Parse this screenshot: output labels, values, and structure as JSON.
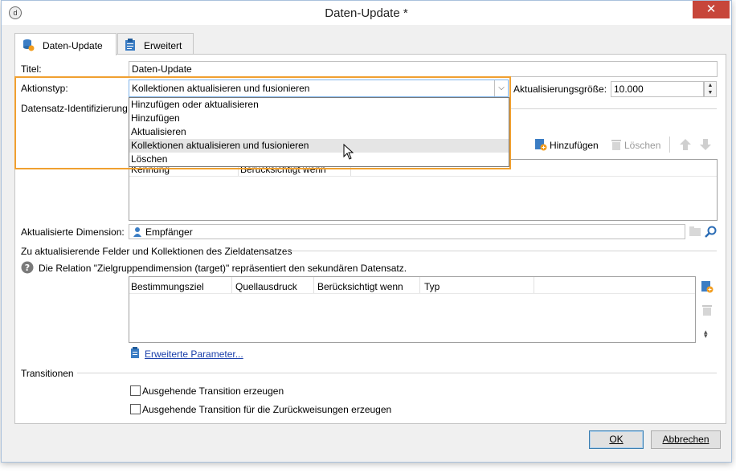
{
  "window": {
    "title": "Daten-Update *",
    "close_label": "✕"
  },
  "tabs": [
    {
      "label": "Daten-Update",
      "icon": "database-update-icon",
      "active": true
    },
    {
      "label": "Erweitert",
      "icon": "clipboard-icon",
      "active": false
    }
  ],
  "form": {
    "title_label": "Titel:",
    "title_value": "Daten-Update",
    "action_label": "Aktionstyp:",
    "action_value": "Kollektionen aktualisieren und fusionieren",
    "batch_label": "Aktualisierungsgröße:",
    "batch_value": "10.000",
    "record_id_label": "Datensatz-Identifizierung",
    "action_options": [
      "Hinzufügen oder aktualisieren",
      "Hinzufügen",
      "Aktualisieren",
      "Kollektionen aktualisieren und fusionieren",
      "Löschen"
    ],
    "hovered_option_index": 3
  },
  "keys_toolbar": {
    "add_label": "Hinzufügen",
    "delete_label": "Löschen"
  },
  "keys_grid": {
    "columns": [
      "Kennung",
      "Berücksichtigt wenn"
    ]
  },
  "dimension": {
    "label": "Aktualisierte Dimension:",
    "value": "Empfänger"
  },
  "fields_section": {
    "title": "Zu aktualisierende Felder und Kollektionen des Zieldatensatzes",
    "info": "Die Relation \"Zielgruppendimension (target)\" repräsentiert den sekundären Datensatz.",
    "columns": [
      "Bestimmungsziel",
      "Quellausdruck",
      "Berücksichtigt wenn",
      "Typ"
    ],
    "advanced_link": "Erweiterte Parameter..."
  },
  "transitions": {
    "title": "Transitionen",
    "options": [
      {
        "label": "Ausgehende Transition erzeugen",
        "checked": false
      },
      {
        "label": "Ausgehende Transition für die Zurückweisungen erzeugen",
        "checked": false
      }
    ]
  },
  "buttons": {
    "ok": "OK",
    "cancel": "Abbrechen"
  },
  "colors": {
    "highlight": "#f0a030",
    "close": "#c7463a",
    "link": "#1a3faa"
  }
}
